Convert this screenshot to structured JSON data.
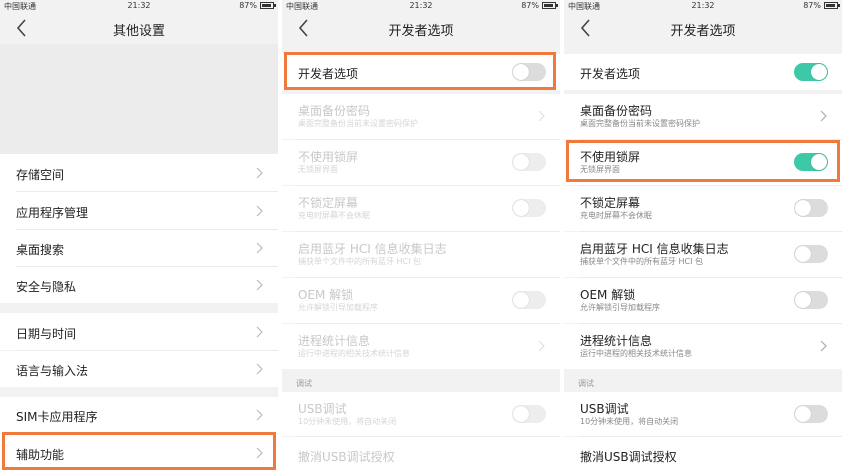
{
  "status": {
    "carrier": "中国联通",
    "time": "21:32",
    "battery": "87%",
    "battery_level": 0.87
  },
  "colors": {
    "toggle_on": "#3dc8a8",
    "highlight": "#f07a3c"
  },
  "panel1": {
    "title": "其他设置",
    "items": [
      {
        "label": "存储空间"
      },
      {
        "label": "应用程序管理"
      },
      {
        "label": "桌面搜索"
      },
      {
        "label": "安全与隐私"
      },
      {
        "label": "日期与时间"
      },
      {
        "label": "语言与输入法"
      },
      {
        "label": "SIM卡应用程序"
      },
      {
        "label": "辅助功能"
      }
    ]
  },
  "panel2": {
    "title": "开发者选项",
    "master": {
      "label": "开发者选项",
      "on": false
    },
    "items": [
      {
        "label": "桌面备份密码",
        "sub": "桌面完整备份当前未设置密码保护"
      },
      {
        "label": "不使用锁屏",
        "sub": "无锁屏界面"
      },
      {
        "label": "不锁定屏幕",
        "sub": "充电时屏幕不会休眠"
      },
      {
        "label": "启用蓝牙 HCI 信息收集日志",
        "sub": "捕获单个文件中的所有蓝牙 HCI 包"
      },
      {
        "label": "OEM 解锁",
        "sub": "允许解锁引导加载程序"
      },
      {
        "label": "进程统计信息",
        "sub": "运行中进程的相关技术统计信息"
      }
    ],
    "section": "调试",
    "usb": {
      "label": "USB调试",
      "sub": "10分钟未使用，将自动关闭"
    },
    "revoke": {
      "label": "撤消USB调试授权"
    }
  },
  "panel3": {
    "title": "开发者选项",
    "master": {
      "label": "开发者选项",
      "on": true
    },
    "items": [
      {
        "label": "桌面备份密码",
        "sub": "桌面完整备份当前未设置密码保护"
      },
      {
        "label": "不使用锁屏",
        "sub": "无锁屏界面",
        "on": true
      },
      {
        "label": "不锁定屏幕",
        "sub": "充电时屏幕不会休眠",
        "on": false
      },
      {
        "label": "启用蓝牙 HCI 信息收集日志",
        "sub": "捕获单个文件中的所有蓝牙 HCI 包",
        "on": false
      },
      {
        "label": "OEM 解锁",
        "sub": "允许解锁引导加载程序",
        "on": false
      },
      {
        "label": "进程统计信息",
        "sub": "运行中进程的相关技术统计信息"
      }
    ],
    "section": "调试",
    "usb": {
      "label": "USB调试",
      "sub": "10分钟未使用，将自动关闭",
      "on": false
    },
    "revoke": {
      "label": "撤消USB调试授权"
    }
  }
}
